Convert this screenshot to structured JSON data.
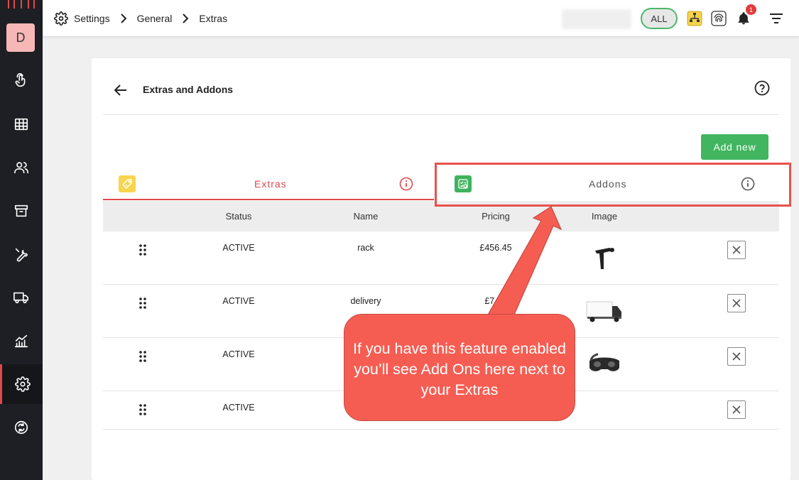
{
  "app": {
    "avatar_initial": "D"
  },
  "breadcrumb": {
    "root": "Settings",
    "level1": "General",
    "level2": "Extras"
  },
  "toolbar": {
    "filter_all_label": "ALL",
    "notification_count": "1"
  },
  "sidebar": {
    "items": [
      {
        "icon": "touch-icon"
      },
      {
        "icon": "grid-icon"
      },
      {
        "icon": "users-icon"
      },
      {
        "icon": "archive-icon"
      },
      {
        "icon": "wrench-icon"
      },
      {
        "icon": "truck-icon"
      },
      {
        "icon": "chart-icon"
      },
      {
        "icon": "gear-icon",
        "active": true
      },
      {
        "icon": "sync-icon"
      }
    ]
  },
  "page": {
    "title": "Extras and Addons",
    "add_new_label": "Add new",
    "tabs": [
      {
        "label": "Extras",
        "active": true,
        "color": "#e0484c"
      },
      {
        "label": "Addons",
        "active": false,
        "color": "#555555"
      }
    ]
  },
  "table": {
    "columns": [
      "Status",
      "Name",
      "Pricing",
      "Image"
    ],
    "rows": [
      {
        "status": "ACTIVE",
        "name": "rack",
        "pricing": "£456.45",
        "image": "tow-hitch"
      },
      {
        "status": "ACTIVE",
        "name": "delivery",
        "pricing": "£7.99",
        "image": "delivery-van"
      },
      {
        "status": "ACTIVE",
        "name": "",
        "pricing": "",
        "image": "vr-headset"
      },
      {
        "status": "ACTIVE",
        "name": "",
        "pricing": "",
        "image": ""
      }
    ]
  },
  "callout": {
    "text": "If you have this feature enabled you’ll see Add Ons here next to your Extras"
  },
  "colors": {
    "accent": "#e0484c",
    "primary_button": "#41b55f",
    "sidebar_bg": "#1d1f24",
    "callout_bg": "#f65d52"
  }
}
